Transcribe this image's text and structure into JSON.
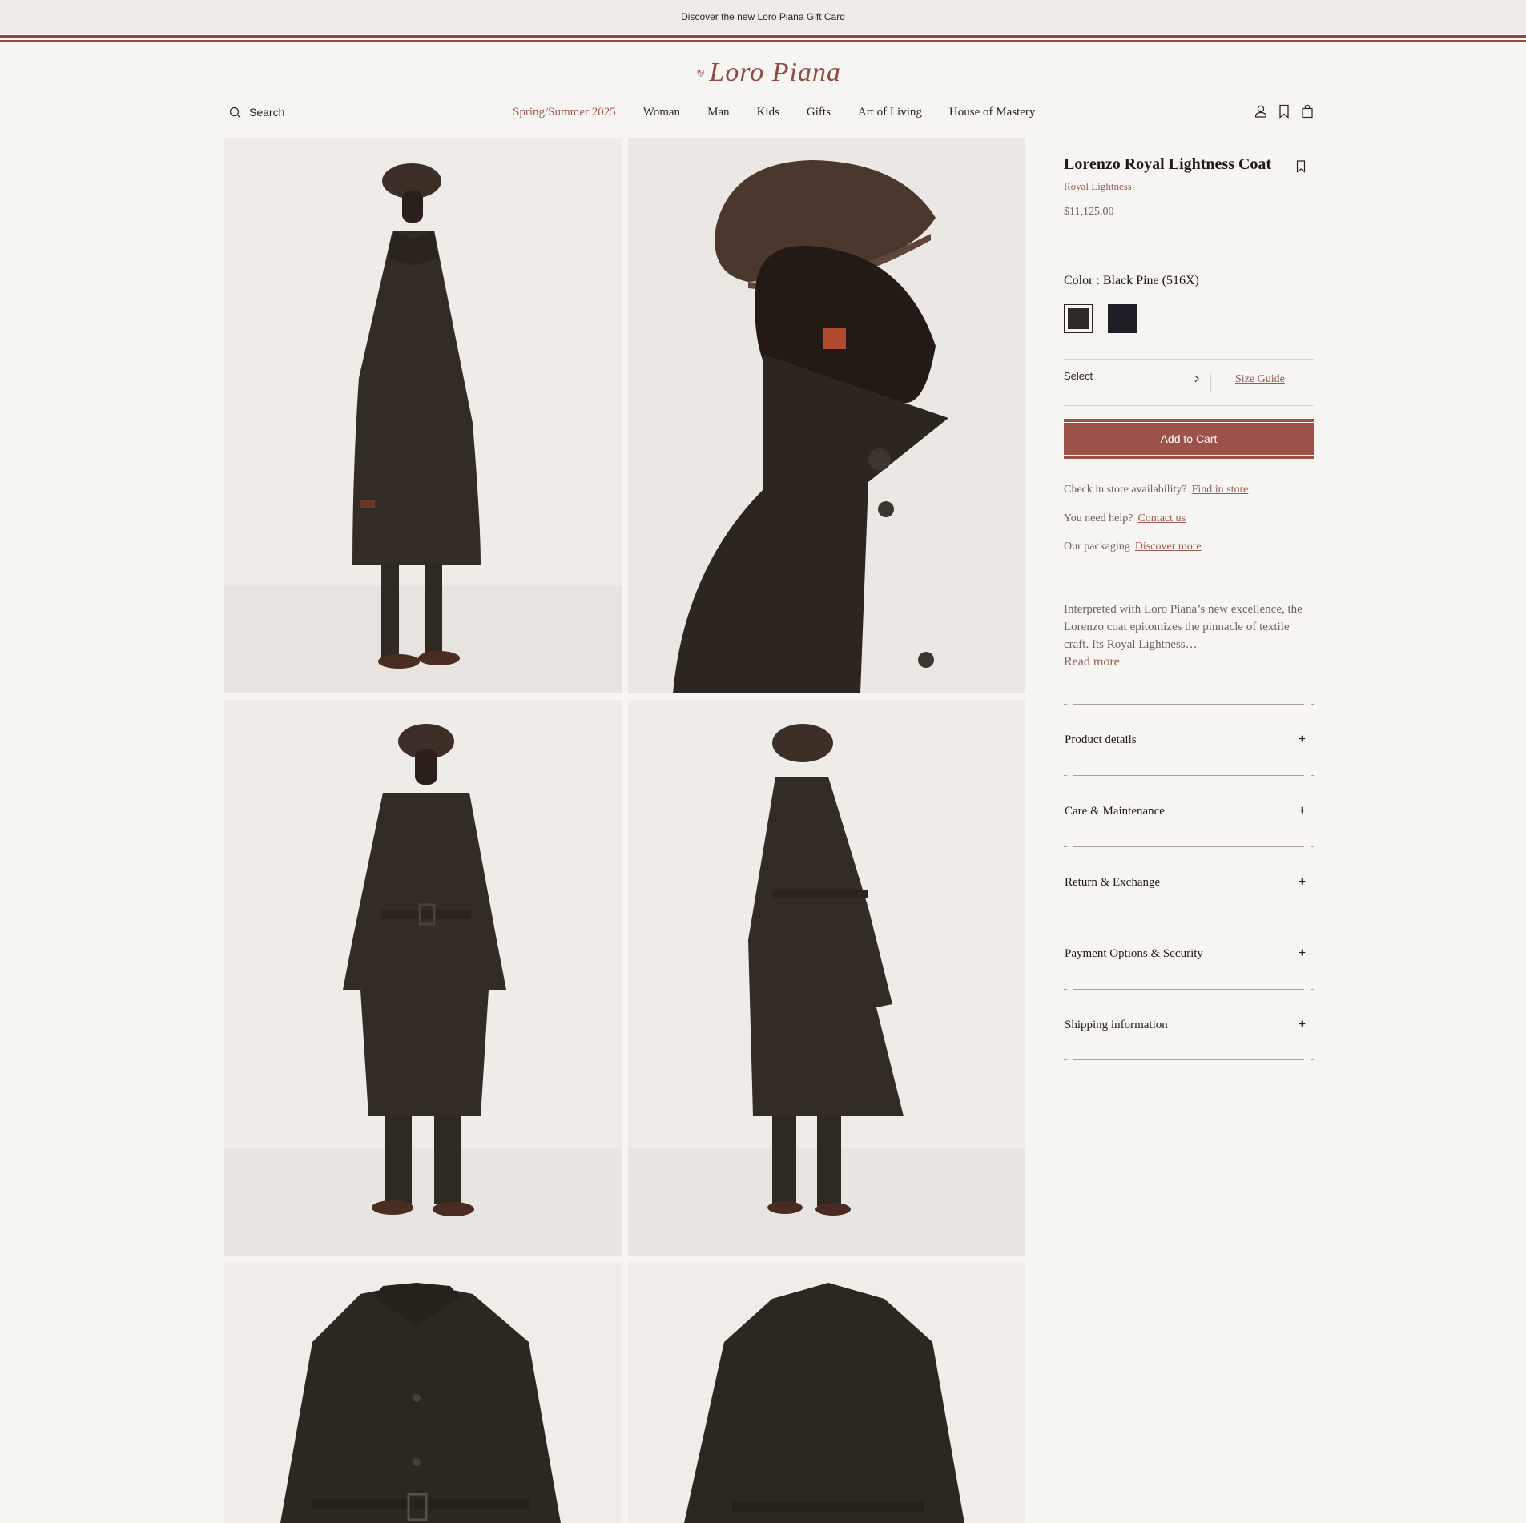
{
  "promo": {
    "text": "Discover the new Loro Piana Gift Card"
  },
  "brand": {
    "name": "Loro Piana",
    "color": "#8e4b43"
  },
  "nav": {
    "search_label": "Search",
    "items": [
      "Spring/Summer 2025",
      "Woman",
      "Man",
      "Kids",
      "Gifts",
      "Art of Living",
      "House of Mastery"
    ],
    "highlight_index": 0,
    "icons": [
      "account-icon",
      "wishlist-icon",
      "bag-icon"
    ]
  },
  "gallery": {
    "images": [
      "coat-front-side-view",
      "coat-collar-profile",
      "coat-front-full",
      "coat-back-full",
      "coat-flat-front",
      "coat-flat-back"
    ]
  },
  "product": {
    "name": "Lorenzo Royal Lightness Coat",
    "collection": "Royal Lightness",
    "price": "$11,125.00",
    "color_label": "Color : Black Pine (516X)",
    "swatches": [
      {
        "name": "Black Pine",
        "hex": "#2f2a25",
        "selected": true
      },
      {
        "name": "Navy",
        "hex": "#1e1f27",
        "selected": false
      }
    ],
    "size_select": "Select",
    "size_guide": "Size Guide",
    "add_to_cart": "Add to Cart",
    "accent_color": "#9c5149"
  },
  "help": {
    "availability": {
      "label": "Check in store availability?",
      "link": "Find in store"
    },
    "support": {
      "label": "You need help?",
      "link": "Contact us"
    },
    "packaging": {
      "label": "Our packaging",
      "link": "Discover more"
    }
  },
  "description": {
    "text": "Interpreted with Loro Piana’s new excellence, the Lorenzo coat epitomizes the pinnacle of textile craft. Its Royal Lightness…",
    "read_more": "Read more"
  },
  "accordion": [
    "Product details",
    "Care & Maintenance",
    "Return & Exchange",
    "Payment Options & Security",
    "Shipping information"
  ]
}
